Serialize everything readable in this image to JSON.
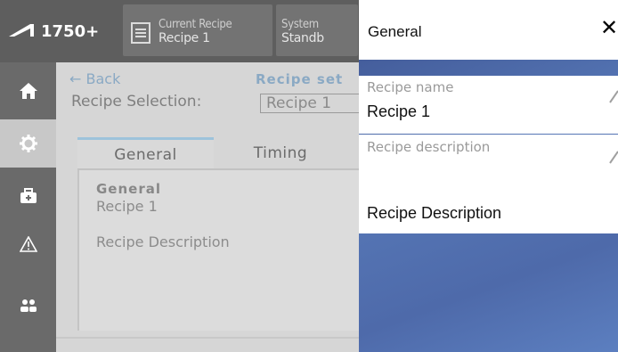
{
  "header": {
    "model": "1750+",
    "current_recipe_label": "Current Recipe",
    "current_recipe_value": "Recipe 1",
    "system_label": "System",
    "system_value": "Standb"
  },
  "rail": {
    "items": [
      "home-icon",
      "gear-icon",
      "toolbox-icon",
      "warning-icon",
      "users-icon"
    ],
    "active": "gear-icon"
  },
  "content": {
    "back_label": "Back",
    "page_title": "Recipe set",
    "selection_label": "Recipe Selection:",
    "selection_value": "Recipe 1",
    "tabs": [
      {
        "label": "General",
        "active": true
      },
      {
        "label": "Timing",
        "active": false
      }
    ],
    "panel": {
      "heading": "General",
      "name": "Recipe 1",
      "description": "Recipe Description"
    }
  },
  "dialog": {
    "title": "General",
    "close_symbol": "✕",
    "fields": [
      {
        "label": "Recipe name",
        "value": "Recipe 1"
      },
      {
        "label": "Recipe description",
        "value": "Recipe Description"
      }
    ]
  },
  "colors": {
    "topbar": "#5e5e5e",
    "rail": "#6a6a6a",
    "accent_link": "#8aa9c4",
    "tab_indicator": "#9dc3db",
    "dialog_backdrop": "#4e6aaa"
  }
}
